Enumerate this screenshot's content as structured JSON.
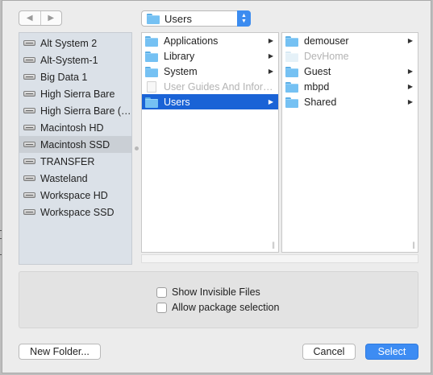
{
  "toolbar": {
    "back_glyph": "◀",
    "forward_glyph": "▶",
    "path_popup_label": "Users"
  },
  "sidebar": {
    "items": [
      {
        "label": "Alt System 2",
        "icon": "disk-icon"
      },
      {
        "label": "Alt-System-1",
        "icon": "disk-icon"
      },
      {
        "label": "Big Data 1",
        "icon": "disk-icon"
      },
      {
        "label": "High Sierra Bare",
        "icon": "disk-icon"
      },
      {
        "label": "High Sierra Bare (…",
        "icon": "disk-icon"
      },
      {
        "label": "Macintosh HD",
        "icon": "disk-icon"
      },
      {
        "label": "Macintosh SSD",
        "icon": "disk-icon",
        "selected": true
      },
      {
        "label": "TRANSFER",
        "icon": "disk-icon"
      },
      {
        "label": "Wasteland",
        "icon": "disk-icon"
      },
      {
        "label": "Workspace HD",
        "icon": "disk-icon"
      },
      {
        "label": "Workspace SSD",
        "icon": "disk-icon"
      }
    ]
  },
  "columns": [
    {
      "items": [
        {
          "label": "Applications",
          "icon": "folder-icon",
          "has_children": true
        },
        {
          "label": "Library",
          "icon": "folder-icon",
          "has_children": true
        },
        {
          "label": "System",
          "icon": "folder-icon",
          "has_children": true
        },
        {
          "label": "User Guides And Infor…",
          "icon": "document-icon",
          "disabled": true
        },
        {
          "label": "Users",
          "icon": "folder-icon",
          "has_children": true,
          "selected": true
        }
      ]
    },
    {
      "items": [
        {
          "label": "demouser",
          "icon": "folder-icon",
          "has_children": true
        },
        {
          "label": "DevHome",
          "icon": "folder-icon",
          "disabled": true
        },
        {
          "label": "Guest",
          "icon": "folder-icon",
          "has_children": true
        },
        {
          "label": "mbpd",
          "icon": "folder-icon",
          "has_children": true
        },
        {
          "label": "Shared",
          "icon": "folder-icon",
          "has_children": true
        }
      ]
    }
  ],
  "options": {
    "show_invisible_label": "Show Invisible Files",
    "show_invisible_checked": false,
    "allow_package_label": "Allow package selection",
    "allow_package_checked": false
  },
  "buttons": {
    "new_folder": "New Folder...",
    "cancel": "Cancel",
    "select": "Select"
  },
  "colors": {
    "selection": "#1a63d6",
    "default_button": "#3d8cf3",
    "sidebar_bg": "#dbe1e8"
  }
}
